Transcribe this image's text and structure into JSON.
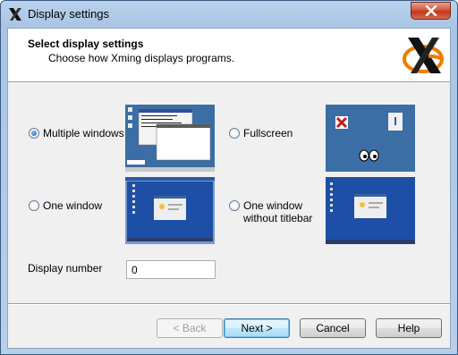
{
  "window": {
    "title": "Display settings"
  },
  "header": {
    "title": "Select display settings",
    "subtitle": "Choose how Xming displays programs."
  },
  "options": [
    {
      "label": "Multiple windows",
      "checked": true
    },
    {
      "label": "Fullscreen",
      "checked": false
    },
    {
      "label": "One window",
      "checked": false
    },
    {
      "label_line1": "One window",
      "label_line2": "without titlebar",
      "checked": false
    }
  ],
  "display_number": {
    "label": "Display number",
    "value": "0"
  },
  "buttons": {
    "back": "< Back",
    "next": "Next >",
    "cancel": "Cancel",
    "help": "Help"
  },
  "colors": {
    "accent": "#3c7fb1",
    "close_red": "#c2361b",
    "logo_orange": "#f07c00"
  },
  "icons": [
    "xming-icon",
    "close-icon",
    "xming-logo"
  ]
}
